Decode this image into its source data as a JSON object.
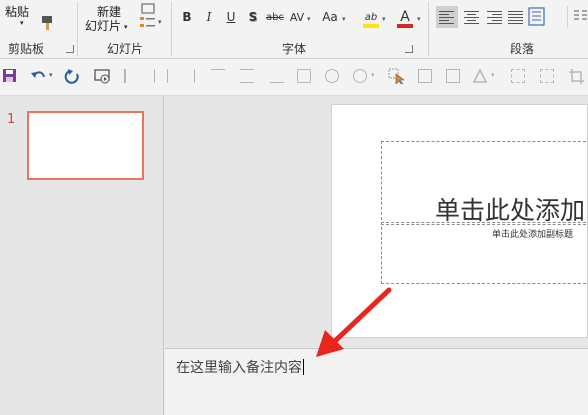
{
  "ribbon": {
    "paste_label": "粘贴",
    "clipboard_group": "剪贴板",
    "new_slide_line1": "新建",
    "new_slide_line2": "幻灯片",
    "slides_group": "幻灯片",
    "font_group": "字体",
    "paragraph_group": "段落",
    "bold": "B",
    "italic": "I",
    "underline": "U",
    "shadow": "S",
    "strikethrough": "abc",
    "char_spacing": "AV",
    "change_case": "Aa",
    "highlight": "ab",
    "font_color": "A",
    "highlight_color": "#ffe600",
    "font_color_bar": "#d02b22"
  },
  "slides": [
    {
      "number": "1"
    }
  ],
  "slide": {
    "title_placeholder": "单击此处添加",
    "subtitle_placeholder": "单击此处添加副标题"
  },
  "notes": {
    "placeholder": "在这里输入备注内容"
  },
  "annotation": {
    "arrow_color": "#e8261c"
  }
}
